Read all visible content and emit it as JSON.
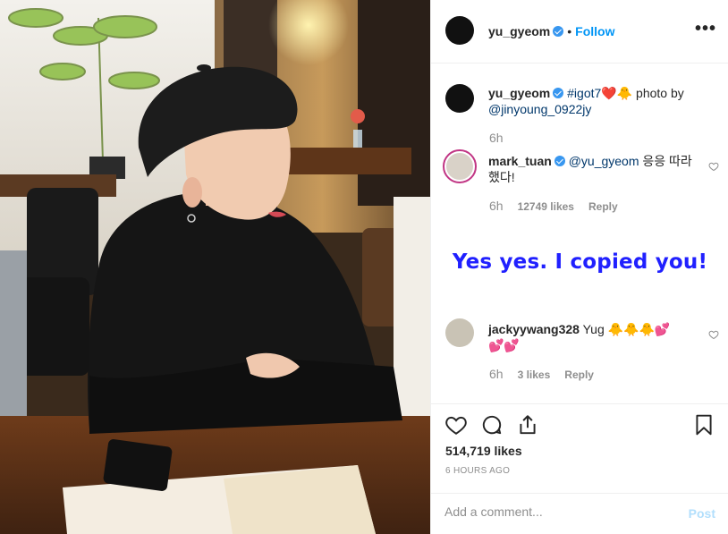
{
  "header": {
    "username": "yu_gyeom",
    "separator": "•",
    "follow_label": "Follow",
    "more_label": "•••"
  },
  "caption": {
    "username": "yu_gyeom",
    "hashtag": "#igot7",
    "emoji": "❤️🐥",
    "text": " photo by",
    "mention": "@jinyoung_0922jy",
    "time": "6h"
  },
  "comments": [
    {
      "username": "mark_tuan",
      "mention": "@yu_gyeom",
      "text": " 응응 따라",
      "text2": "했다!",
      "time": "6h",
      "likes": "12749 likes",
      "reply": "Reply"
    },
    {
      "username": "jackyywang328",
      "text": " Yug 🐥🐥🐥💕",
      "text2": "💕💕",
      "time": "6h",
      "likes": "3 likes",
      "reply": "Reply"
    }
  ],
  "translation_overlay": "Yes yes. I copied you!",
  "actions": {
    "icons": [
      "heart-icon",
      "comment-icon",
      "share-icon",
      "bookmark-icon"
    ],
    "likes": "514,719 likes",
    "timestamp": "6 HOURS AGO"
  },
  "comment_box": {
    "placeholder": "Add a comment...",
    "post_label": "Post"
  },
  "colors": {
    "follow": "#0095f6",
    "verified": "#3897f0",
    "overlay_text": "#2020ff",
    "post_disabled": "#b2dffc"
  }
}
